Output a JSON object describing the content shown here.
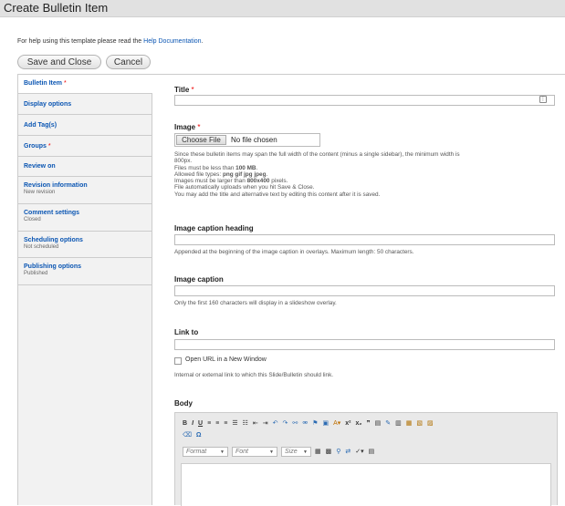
{
  "window": {
    "title": "Create Bulletin Item"
  },
  "help": {
    "prefix": "For help using this template please read the",
    "link": "Help Documentation",
    "suffix": "."
  },
  "actions": {
    "save": "Save and Close",
    "cancel": "Cancel"
  },
  "tabs": [
    {
      "label": "Bulletin Item",
      "required": "*",
      "sub": ""
    },
    {
      "label": "Display options",
      "required": "",
      "sub": ""
    },
    {
      "label": "Add Tag(s)",
      "required": "",
      "sub": ""
    },
    {
      "label": "Groups",
      "required": "*",
      "sub": ""
    },
    {
      "label": "Review on",
      "required": "",
      "sub": ""
    },
    {
      "label": "Revision information",
      "required": "",
      "sub": "New revision"
    },
    {
      "label": "Comment settings",
      "required": "",
      "sub": "Closed"
    },
    {
      "label": "Scheduling options",
      "required": "",
      "sub": "Not scheduled"
    },
    {
      "label": "Publishing options",
      "required": "",
      "sub": "Published"
    }
  ],
  "fields": {
    "title": {
      "label": "Title",
      "required": "*",
      "value": ""
    },
    "image": {
      "label": "Image",
      "required": "*",
      "choose": "Choose File",
      "status": "No file chosen",
      "help_lines": [
        "Since these bulletin items may span the full width of the content (minus a single sidebar), the minimum width is",
        "800px.",
        "Files must be less than",
        "100 MB",
        "Allowed file types:",
        "png gif jpg jpeg",
        "Images must be larger than",
        "800x400",
        "pixels.",
        "File automatically uploads when you hit Save & Close.",
        "You may add the title and alternative text by editing this content after it is saved."
      ]
    },
    "caption_heading": {
      "label": "Image caption heading",
      "value": "",
      "help": "Appended at the beginning of the image caption in overlays. Maximum length: 50 characters."
    },
    "caption": {
      "label": "Image caption",
      "value": "",
      "help": "Only the first 160 characters will display in a slideshow overlay."
    },
    "link": {
      "label": "Link to",
      "value": "",
      "new_window": "Open URL in a New Window",
      "new_window_checked": false,
      "help": "Internal or external link to which this Slide/Bulletin should link."
    },
    "body": {
      "label": "Body",
      "format": "Format",
      "font": "Font",
      "size": "Size"
    }
  },
  "icons": {
    "title_field": "ellipsis-icon",
    "toolbar": [
      "bold-icon",
      "italic-icon",
      "underline-icon",
      "align-left-icon",
      "align-center-icon",
      "align-right-icon",
      "bulleted-list-icon",
      "numbered-list-icon",
      "outdent-icon",
      "indent-icon",
      "undo-icon",
      "redo-icon",
      "link-icon",
      "unlink-icon",
      "anchor-icon",
      "image-icon",
      "text-color-icon",
      "superscript-icon",
      "subscript-icon",
      "blockquote-icon",
      "horizontal-rule-icon",
      "remove-format-icon",
      "paste-icon",
      "paste-text-icon",
      "paste-word-icon",
      "paste-from-word-icon",
      "eraser-icon",
      "special-character-icon",
      "table-icon",
      "show-blocks-icon",
      "find-icon",
      "replace-icon",
      "spellcheck-icon",
      "source-icon"
    ]
  },
  "colors": {
    "link": "#0b56b3",
    "required": "#ee0000",
    "titlebar": "#e1e1e1"
  }
}
